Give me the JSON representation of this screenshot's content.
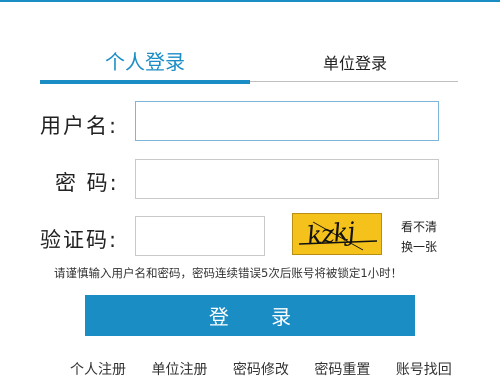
{
  "tabs": {
    "personal": "个人登录",
    "unit": "单位登录"
  },
  "form": {
    "username_label": "用户名:",
    "password_label": "密 码:",
    "captcha_label": "验证码:",
    "username_value": "",
    "password_value": "",
    "captcha_value": ""
  },
  "captcha": {
    "text": "kzkj",
    "refresh_line1": "看不清",
    "refresh_line2": "换一张"
  },
  "notice": "请谨慎输入用户名和密码，密码连续错误5次后账号将被锁定1小时！",
  "login_button": "登 录",
  "links": [
    "个人注册",
    "单位注册",
    "密码修改",
    "密码重置",
    "账号找回"
  ],
  "colors": {
    "accent": "#1a8dc5",
    "captcha_bg": "#f4c21a"
  }
}
